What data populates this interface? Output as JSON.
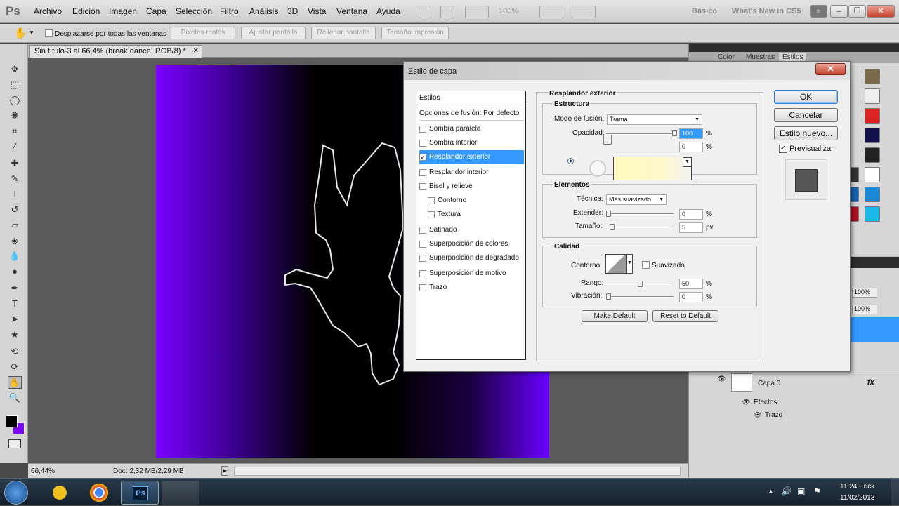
{
  "app": {
    "logo": "Ps"
  },
  "menu": [
    "Archivo",
    "Edición",
    "Imagen",
    "Capa",
    "Selección",
    "Filtro",
    "Análisis",
    "3D",
    "Vista",
    "Ventana",
    "Ayuda"
  ],
  "topbar": {
    "zoom": "100%",
    "workspace_basic": "Básico",
    "workspace_new": "What's New in CS5"
  },
  "options": {
    "scroll_all": "Desplazarse por todas las ventanas",
    "buttons": [
      "Píxeles reales",
      "Ajustar pantalla",
      "Rellenar pantalla",
      "Tamaño impresión"
    ]
  },
  "document": {
    "tab_title": "Sin título-3 al 66,4% (break dance, RGB/8) *"
  },
  "status": {
    "zoom": "66,44%",
    "doc": "Doc: 2,32 MB/2,29 MB"
  },
  "panels": {
    "tabs": [
      "Color",
      "Muestras",
      "Estilos"
    ],
    "opacity1": "100%",
    "opacity2": "100%",
    "layer_name": "Capa 0",
    "effects": "Efectos",
    "effect_item": "Trazo",
    "fx": "fx"
  },
  "dialog": {
    "title": "Estilo de capa",
    "styles_header": "Estilos",
    "list": [
      {
        "label": "Opciones de fusión: Por defecto",
        "check": false,
        "hasbox": false,
        "sub": false,
        "sel": false
      },
      {
        "label": "Sombra paralela",
        "check": false,
        "hasbox": true,
        "sub": false,
        "sel": false
      },
      {
        "label": "Sombra interior",
        "check": false,
        "hasbox": true,
        "sub": false,
        "sel": false
      },
      {
        "label": "Resplandor exterior",
        "check": true,
        "hasbox": true,
        "sub": false,
        "sel": true
      },
      {
        "label": "Resplandor interior",
        "check": false,
        "hasbox": true,
        "sub": false,
        "sel": false
      },
      {
        "label": "Bisel y relieve",
        "check": false,
        "hasbox": true,
        "sub": false,
        "sel": false
      },
      {
        "label": "Contorno",
        "check": false,
        "hasbox": true,
        "sub": true,
        "sel": false
      },
      {
        "label": "Textura",
        "check": false,
        "hasbox": true,
        "sub": true,
        "sel": false
      },
      {
        "label": "Satinado",
        "check": false,
        "hasbox": true,
        "sub": false,
        "sel": false
      },
      {
        "label": "Superposición de colores",
        "check": false,
        "hasbox": true,
        "sub": false,
        "sel": false
      },
      {
        "label": "Superposición de degradado",
        "check": false,
        "hasbox": true,
        "sub": false,
        "sel": false
      },
      {
        "label": "Superposición de motivo",
        "check": false,
        "hasbox": true,
        "sub": false,
        "sel": false
      },
      {
        "label": "Trazo",
        "check": false,
        "hasbox": true,
        "sub": false,
        "sel": false
      }
    ],
    "section_title": "Resplandor exterior",
    "estructura": {
      "title": "Estructura",
      "blend_label": "Modo de fusión:",
      "blend_value": "Trama",
      "opacity_label": "Opacidad:",
      "opacity_value": "100",
      "opacity_unit": "%",
      "noise_value": "0",
      "noise_unit": "%"
    },
    "elementos": {
      "title": "Elementos",
      "tech_label": "Técnica:",
      "tech_value": "Más suavizado",
      "spread_label": "Extender:",
      "spread_value": "0",
      "spread_unit": "%",
      "size_label": "Tamaño:",
      "size_value": "5",
      "size_unit": "px"
    },
    "calidad": {
      "title": "Calidad",
      "contour_label": "Contorno:",
      "antialias_label": "Suavizado",
      "range_label": "Rango:",
      "range_value": "50",
      "range_unit": "%",
      "jitter_label": "Vibración:",
      "jitter_value": "0",
      "jitter_unit": "%"
    },
    "make_default": "Make Default",
    "reset_default": "Reset to Default",
    "ok": "OK",
    "cancel": "Cancelar",
    "new_style": "Estilo nuevo...",
    "preview": "Previsualizar"
  },
  "taskbar": {
    "time": "11:24",
    "user": "Erick",
    "date": "11/02/2013",
    "ps_label": "Ps"
  }
}
